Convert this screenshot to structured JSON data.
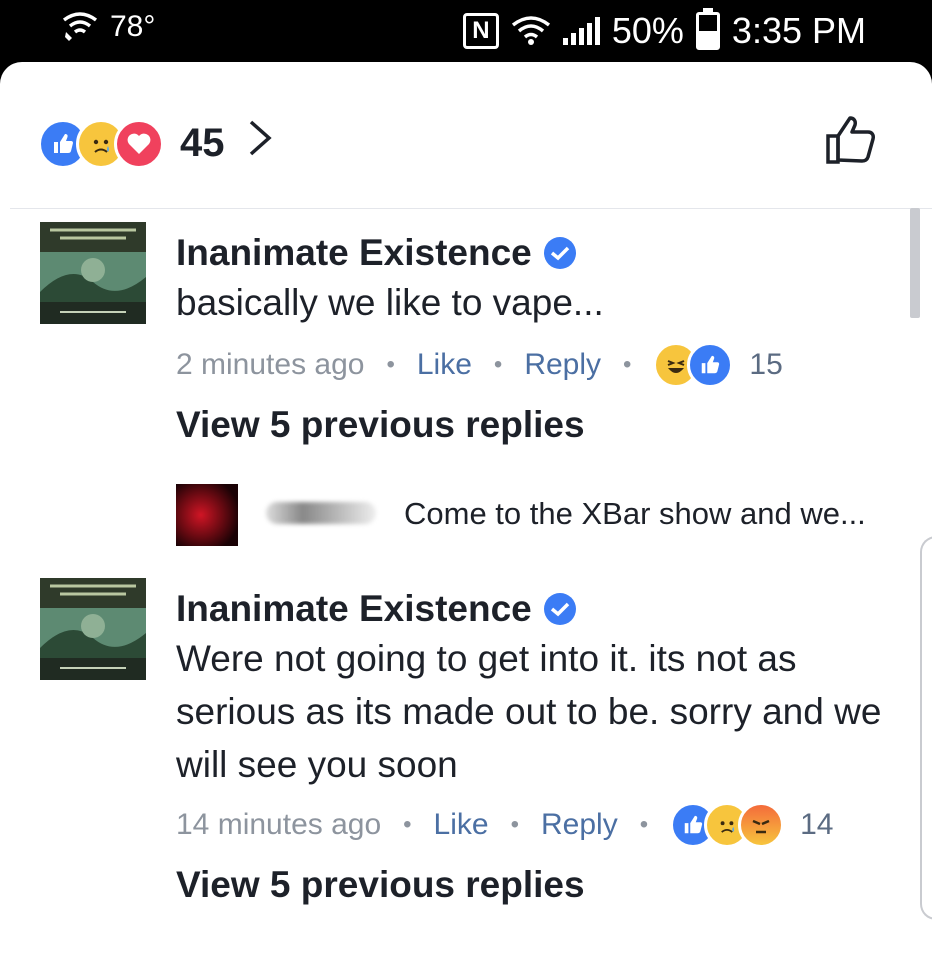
{
  "status_bar": {
    "temperature": "78°",
    "battery_percent": "50%",
    "battery_level": 0.5,
    "time": "3:35 PM",
    "nfc_label": "N"
  },
  "header": {
    "reaction_icons": [
      "like-reaction",
      "sad-reaction",
      "love-reaction"
    ],
    "total_reactions": "45",
    "chevron": "chevron-right-icon",
    "like_button_icon": "thumbs-up-outline-icon"
  },
  "comments": [
    {
      "author": "Inanimate Existence",
      "verified": true,
      "text": "basically we like to vape...",
      "time": "2 minutes ago",
      "like_label": "Like",
      "reply_label": "Reply",
      "reactions": [
        "haha-reaction",
        "like-reaction"
      ],
      "reaction_count": "15",
      "view_previous": "View 5 previous replies",
      "reply_preview": {
        "author_blurred": true,
        "text": "Come to the XBar show and we..."
      }
    },
    {
      "author": "Inanimate Existence",
      "verified": true,
      "text": "Were not going to get into it. its not as serious as its made out to be. sorry and we will see you soon",
      "time": "14 minutes ago",
      "like_label": "Like",
      "reply_label": "Reply",
      "reactions": [
        "like-reaction",
        "sad-reaction",
        "angry-reaction"
      ],
      "reaction_count": "14",
      "view_previous": "View 5 previous replies"
    }
  ],
  "colors": {
    "like_blue": "#3b7cf5",
    "link_blue": "#4b6fa3",
    "meta_gray": "#8d949e",
    "love_red": "#f0415d",
    "emoji_yellow": "#f7c53d"
  }
}
